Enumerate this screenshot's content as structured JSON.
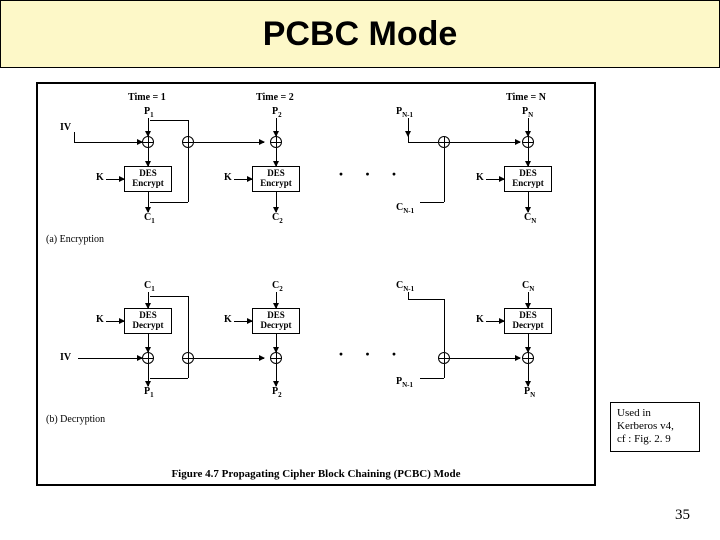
{
  "title": "PCBC Mode",
  "caption": "Figure 4.7   Propagating Cipher Block Chaining (PCBC) Mode",
  "note": {
    "line1": "Used in",
    "line2": "Kerberos v4,",
    "line3": "cf : Fig. 2. 9"
  },
  "slide_number": "35",
  "labels": {
    "time1": "Time = 1",
    "time2": "Time = 2",
    "timeN": "Time = N",
    "iv": "IV",
    "k": "K",
    "des_encrypt_t": "DES",
    "des_encrypt_b": "Encrypt",
    "des_decrypt_t": "DES",
    "des_decrypt_b": "Decrypt",
    "enc_section": "(a) Encryption",
    "dec_section": "(b) Decryption"
  },
  "enc": {
    "p1": "P",
    "p1s": "1",
    "p2": "P",
    "p2s": "2",
    "pn1": "P",
    "pn1s": "N-1",
    "pn": "P",
    "pns": "N",
    "c1": "C",
    "c1s": "1",
    "c2": "C",
    "c2s": "2",
    "cn1": "C",
    "cn1s": "N-1",
    "cn": "C",
    "cns": "N"
  },
  "dec": {
    "c1": "C",
    "c1s": "1",
    "c2": "C",
    "c2s": "2",
    "cn1": "C",
    "cn1s": "N-1",
    "cn": "C",
    "cns": "N",
    "p1": "P",
    "p1s": "1",
    "p2": "P",
    "p2s": "2",
    "pn1": "P",
    "pn1s": "N-1",
    "pn": "P",
    "pns": "N"
  },
  "chart_data": {
    "type": "diagram",
    "title": "Propagating Cipher Block Chaining (PCBC) Mode",
    "sections": [
      "Encryption",
      "Decryption"
    ],
    "stages": [
      "Time = 1",
      "Time = 2",
      "...",
      "Time = N"
    ],
    "encryption_blocks": [
      {
        "stage": 1,
        "input_plain": "P1",
        "extra_in": "IV",
        "op": "DES Encrypt",
        "key": "K",
        "output_cipher": "C1"
      },
      {
        "stage": 2,
        "input_plain": "P2",
        "feedback": [
          "P1",
          "C1"
        ],
        "op": "DES Encrypt",
        "key": "K",
        "output_cipher": "C2"
      },
      {
        "stage": "N",
        "input_plain": "PN",
        "feedback": [
          "P(N-1)",
          "C(N-1)"
        ],
        "op": "DES Encrypt",
        "key": "K",
        "output_cipher": "CN"
      }
    ],
    "decryption_blocks": [
      {
        "stage": 1,
        "input_cipher": "C1",
        "op": "DES Decrypt",
        "key": "K",
        "extra_in": "IV",
        "output_plain": "P1"
      },
      {
        "stage": 2,
        "input_cipher": "C2",
        "op": "DES Decrypt",
        "key": "K",
        "feedback": [
          "C1",
          "P1"
        ],
        "output_plain": "P2"
      },
      {
        "stage": "N",
        "input_cipher": "CN",
        "op": "DES Decrypt",
        "key": "K",
        "feedback": [
          "C(N-1)",
          "P(N-1)"
        ],
        "output_plain": "PN"
      }
    ]
  }
}
